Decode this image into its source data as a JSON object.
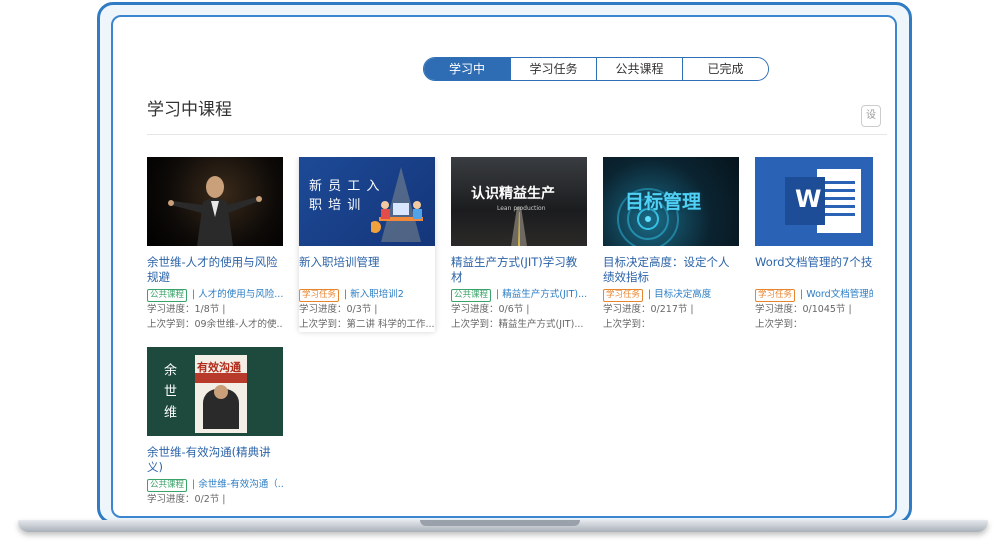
{
  "tabs": [
    {
      "label": "学习中",
      "active": true
    },
    {
      "label": "学习任务",
      "active": false
    },
    {
      "label": "公共课程",
      "active": false
    },
    {
      "label": "已完成",
      "active": false
    }
  ],
  "page_title": "学习中课程",
  "side_button": "设",
  "colors": {
    "accent": "#2e6db4",
    "link": "#2b63a8",
    "public_tag": "#3aa36a",
    "task_tag": "#e8862f"
  },
  "courses": [
    {
      "title": "余世维-人才的使用与风险规避",
      "tag": "公共课程",
      "tag_type": "public",
      "source": "人才的使用与风险...",
      "progress": "学习进度：1/8节 |",
      "last": "上次学到：09余世维-人才的使...",
      "thumb_text": ""
    },
    {
      "title": "新入职培训管理",
      "tag": "学习任务",
      "tag_type": "task",
      "source": "新入职培训2",
      "progress": "学习进度：0/3节 |",
      "last": "上次学到：第二讲 科学的工作...",
      "thumb_text": "新 员 工 入",
      "thumb_text2": "职 培 训"
    },
    {
      "title": "精益生产方式(JIT)学习教材",
      "tag": "公共课程",
      "tag_type": "public",
      "source": "精益生产方式(JIT)...",
      "progress": "学习进度：0/6节 |",
      "last": "上次学到：精益生产方式(JIT)...",
      "thumb_text": "认识精益生产",
      "thumb_sub": "Lean production"
    },
    {
      "title": "目标决定高度：设定个人绩效指标",
      "tag": "学习任务",
      "tag_type": "task",
      "source": "目标决定高度",
      "progress": "学习进度：0/217节 |",
      "last": "上次学到：",
      "thumb_text": "目标管理"
    },
    {
      "title": "Word文档管理的7个技巧",
      "tag": "学习任务",
      "tag_type": "task",
      "source": "Word文档管理的",
      "progress": "学习进度：0/1045节 |",
      "last": "上次学到：",
      "thumb_text": "W"
    },
    {
      "title": "余世维-有效沟通(精典讲义)",
      "tag": "公共课程",
      "tag_type": "public",
      "source": "余世维-有效沟通（...",
      "progress": "学习进度：0/2节 |",
      "last": "",
      "thumb_text": "余 世 维",
      "thumb_text2": "有效沟通"
    }
  ]
}
